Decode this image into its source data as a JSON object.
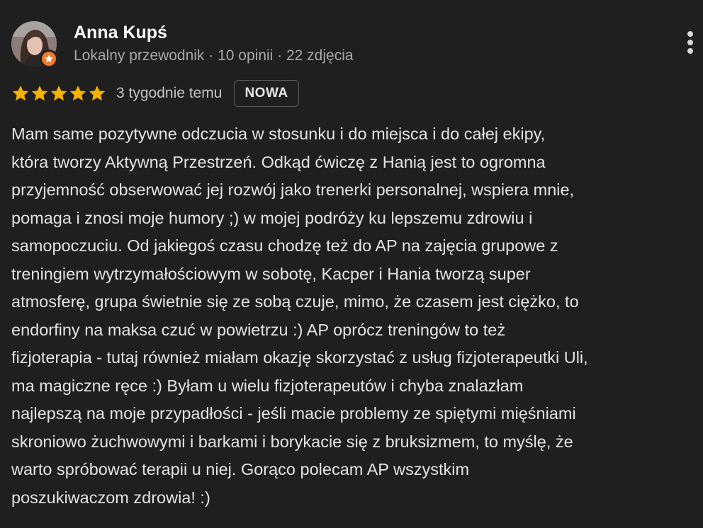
{
  "review": {
    "author": {
      "name": "Anna Kupś",
      "meta": "Lokalny przewodnik · 10 opinii · 22 zdjęcia",
      "avatar_icon": "profile-photo",
      "badge_icon": "local-guide-star-icon"
    },
    "rating": {
      "stars": 5,
      "max_stars": 5,
      "star_color": "#f6b400",
      "date": "3 tygodnie temu",
      "badge": "NOWA"
    },
    "more_icon": "more-vert-icon",
    "text_lines": [
      "Mam same pozytywne odczucia w stosunku i do miejsca i do całej ekipy,",
      "która tworzy Aktywną Przestrzeń. Odkąd ćwiczę z Hanią jest to ogromna",
      "przyjemność obserwować jej rozwój jako trenerki personalnej, wspiera mnie,",
      "pomaga i znosi moje humory ;) w mojej podróży ku lepszemu zdrowiu i",
      "samopoczuciu. Od jakiegoś czasu chodzę też do AP na zajęcia grupowe z",
      "treningiem wytrzymałościowym w sobotę, Kacper i Hania tworzą super",
      "atmosferę, grupa świetnie się ze sobą czuje, mimo, że czasem jest ciężko, to",
      "endorfiny na maksa czuć w powietrzu :) AP oprócz treningów to też",
      "fizjoterapia - tutaj również miałam okazję skorzystać z usług fizjoterapeutki Uli,",
      "ma magiczne ręce :) Byłam u wielu fizjoterapeutów i chyba znalazłam",
      "najlepszą na moje przypadłości - jeśli macie problemy ze spiętymi mięśniami",
      "skroniowo żuchwowymi i barkami i borykacie się z bruksizmem, to myślę, że",
      "warto spróbować terapii u niej. Gorąco polecam AP wszystkim",
      "poszukiwaczom zdrowia! :)"
    ]
  }
}
